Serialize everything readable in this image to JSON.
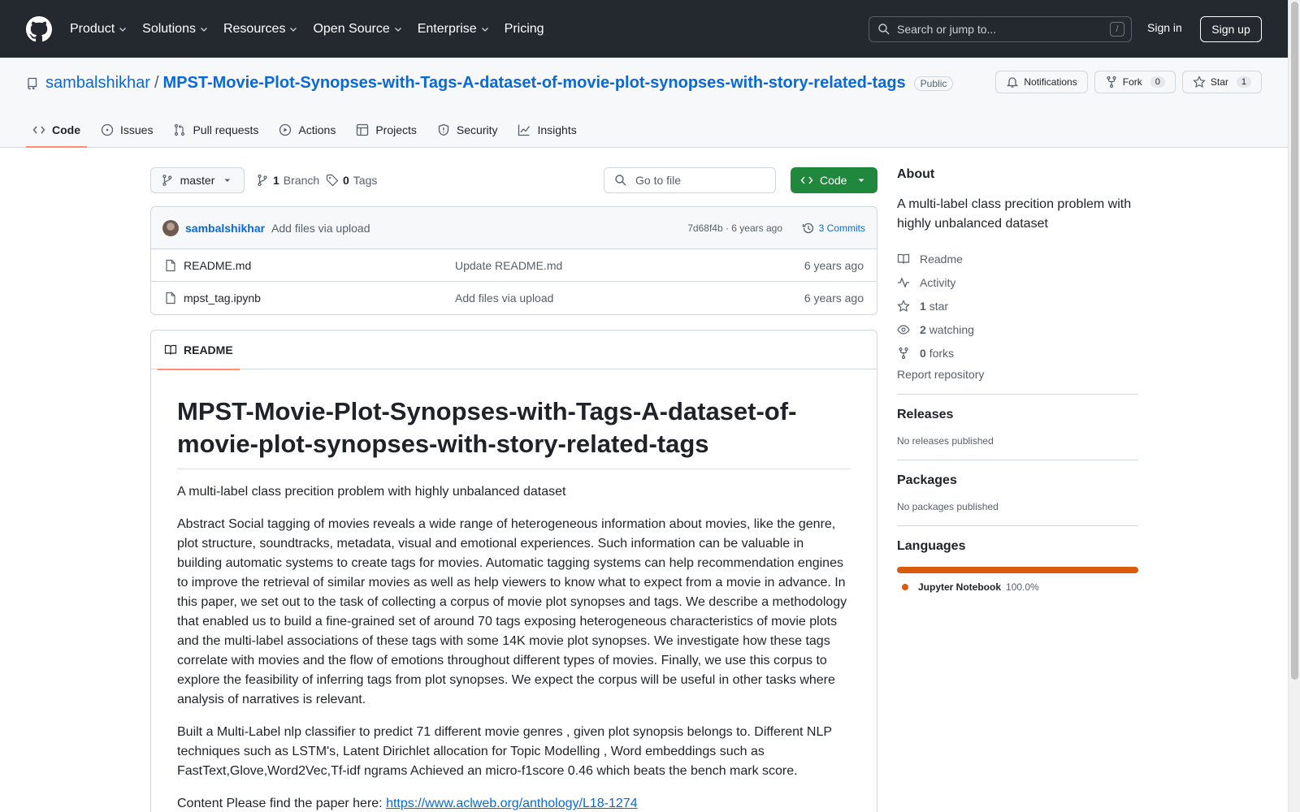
{
  "topnav": {
    "items": [
      "Product",
      "Solutions",
      "Resources",
      "Open Source",
      "Enterprise",
      "Pricing"
    ],
    "search_placeholder": "Search or jump to...",
    "search_shortcut": "/",
    "signin": "Sign in",
    "signup": "Sign up"
  },
  "repo": {
    "owner": "sambalshikhar",
    "separator": "/",
    "name": "MPST-Movie-Plot-Synopses-with-Tags-A-dataset-of-movie-plot-synopses-with-story-related-tags",
    "visibility": "Public",
    "notifications_label": "Notifications",
    "fork_label": "Fork",
    "fork_count": "0",
    "star_label": "Star",
    "star_count": "1"
  },
  "tabs": [
    {
      "label": "Code",
      "icon": "code-icon"
    },
    {
      "label": "Issues",
      "icon": "issue-icon"
    },
    {
      "label": "Pull requests",
      "icon": "pull-request-icon"
    },
    {
      "label": "Actions",
      "icon": "play-icon"
    },
    {
      "label": "Projects",
      "icon": "table-icon"
    },
    {
      "label": "Security",
      "icon": "shield-icon"
    },
    {
      "label": "Insights",
      "icon": "graph-icon"
    }
  ],
  "branchbar": {
    "branch": "master",
    "branch_count": "1",
    "branch_label": "Branch",
    "tag_count": "0",
    "tag_label": "Tags",
    "goto_placeholder": "Go to file",
    "code_button": "Code"
  },
  "commit": {
    "author": "sambalshikhar",
    "message": "Add files via upload",
    "sha_age": "7d68f4b · 6 years ago",
    "commits": "3 Commits"
  },
  "files": [
    {
      "name": "README.md",
      "message": "Update README.md",
      "age": "6 years ago"
    },
    {
      "name": "mpst_tag.ipynb",
      "message": "Add files via upload",
      "age": "6 years ago"
    }
  ],
  "readme": {
    "tab": "README",
    "title": "MPST-Movie-Plot-Synopses-with-Tags-A-dataset-of-movie-plot-synopses-with-story-related-tags",
    "p1": "A multi-label class precition problem with highly unbalanced dataset",
    "p2": "Abstract Social tagging of movies reveals a wide range of heterogeneous information about movies, like the genre, plot structure, soundtracks, metadata, visual and emotional experiences. Such information can be valuable in building automatic systems to create tags for movies. Automatic tagging systems can help recommendation engines to improve the retrieval of similar movies as well as help viewers to know what to expect from a movie in advance. In this paper, we set out to the task of collecting a corpus of movie plot synopses and tags. We describe a methodology that enabled us to build a fine-grained set of around 70 tags exposing heterogeneous characteristics of movie plots and the multi-label associations of these tags with some 14K movie plot synopses. We investigate how these tags correlate with movies and the flow of emotions throughout different types of movies. Finally, we use this corpus to explore the feasibility of inferring tags from plot synopses. We expect the corpus will be useful in other tasks where analysis of narratives is relevant.",
    "p3": "Built a Multi-Label nlp classifier to predict 71 different movie genres , given plot synopsis belongs to. Different NLP techniques such as LSTM's, Latent Dirichlet allocation for Topic Modelling , Word embeddings such as FastText,Glove,Word2Vec,Tf-idf ngrams Achieved an micro-f1score 0.46 which beats the bench mark score.",
    "p4_prefix": "Content Please find the paper here: ",
    "p4_link": "https://www.aclweb.org/anthology/L18-1274"
  },
  "about": {
    "heading": "About",
    "description": "A multi-label class precition problem with highly unbalanced dataset",
    "readme": "Readme",
    "activity": "Activity",
    "stars_count": "1",
    "stars_label": "star",
    "watching_count": "2",
    "watching_label": "watching",
    "forks_count": "0",
    "forks_label": "forks",
    "report": "Report repository"
  },
  "releases": {
    "heading": "Releases",
    "text": "No releases published"
  },
  "packages": {
    "heading": "Packages",
    "text": "No packages published"
  },
  "languages": {
    "heading": "Languages",
    "items": [
      {
        "name": "Jupyter Notebook",
        "percent": "100.0%",
        "color": "#DA5B0B"
      }
    ]
  },
  "colors": {
    "header_bg": "#24292f",
    "link": "#0969da",
    "code_button": "#1f883d",
    "tab_underline": "#fd8c73"
  }
}
